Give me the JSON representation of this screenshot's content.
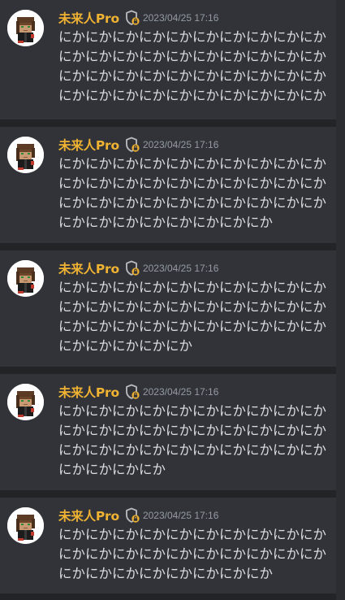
{
  "messages": [
    {
      "username": "未来人Pro",
      "role_icon": "shield-badge-icon",
      "timestamp": "2023/04/25 17:16",
      "content": "にかにかにかにかにかにかにかにかにかにかにかにかにかにかにかにかにかにかにかにかにかにかにかにかにかにかにかにかにかにかにかにかにかにかにかにかにかにかにかにか"
    },
    {
      "username": "未来人Pro",
      "role_icon": "shield-badge-icon",
      "timestamp": "2023/04/25 17:16",
      "content": "にかにかにかにかにかにかにかにかにかにかにかにかにかにかにかにかにかにかにかにかにかにかにかにかにかにかにかにかにかにかにかにかにかにかにかにかにかにか"
    },
    {
      "username": "未来人Pro",
      "role_icon": "shield-badge-icon",
      "timestamp": "2023/04/25 17:16",
      "content": "にかにかにかにかにかにかにかにかにかにかにかにかにかにかにかにかにかにかにかにかにかにかにかにかにかにかにかにかにかにかにかにかにかにかにか"
    },
    {
      "username": "未来人Pro",
      "role_icon": "shield-badge-icon",
      "timestamp": "2023/04/25 17:16",
      "content": "にかにかにかにかにかにかにかにかにかにかにかにかにかにかにかにかにかにかにかにかにかにかにかにかにかにかにかにかにかにかにかにかにかにか"
    },
    {
      "username": "未来人Pro",
      "role_icon": "shield-badge-icon",
      "timestamp": "2023/04/25 17:16",
      "content": "にかにかにかにかにかにかにかにかにかにかにかにかにかにかにかにかにかにかにかにかにかにかにかにかにかにかにかにか"
    }
  ],
  "colors": {
    "username": "#f0b232",
    "timestamp": "#949ba4",
    "message_text": "#dbdee1",
    "card_background": "#313338",
    "gap_background": "#232428"
  }
}
